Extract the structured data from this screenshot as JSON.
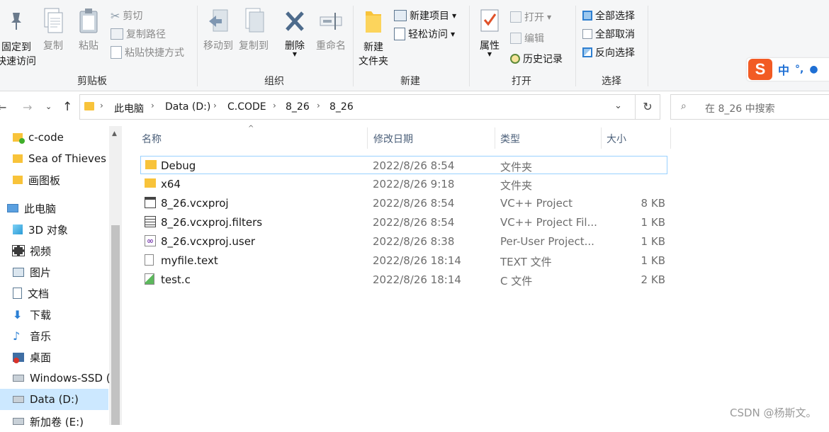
{
  "ribbon": {
    "clipboard": {
      "pin_line1": "固定到",
      "pin_line2": "快速访问",
      "copy": "复制",
      "paste": "粘贴",
      "cut": "剪切",
      "copy_path": "复制路径",
      "paste_shortcut": "粘贴快捷方式",
      "group_label": "剪贴板"
    },
    "organize": {
      "move_to": "移动到",
      "copy_to": "复制到",
      "delete": "删除",
      "rename": "重命名",
      "group_label": "组织"
    },
    "new": {
      "new_folder_line1": "新建",
      "new_folder_line2": "文件夹",
      "new_item": "新建项目",
      "easy_access": "轻松访问",
      "group_label": "新建"
    },
    "open": {
      "properties": "属性",
      "open": "打开",
      "edit": "编辑",
      "history": "历史记录",
      "group_label": "打开"
    },
    "select": {
      "select_all": "全部选择",
      "select_none": "全部取消",
      "invert": "反向选择",
      "group_label": "选择"
    }
  },
  "ime": {
    "mode": "中",
    "punct": "°,"
  },
  "address": {
    "crumbs": [
      "此电脑",
      "Data (D:)",
      "C.CODE",
      "8_26",
      "8_26"
    ],
    "search_placeholder": "在 8_26 中搜索"
  },
  "nav": {
    "items": [
      {
        "label": "c-code",
        "icon": "folder-icon"
      },
      {
        "label": "Sea of Thieves",
        "icon": "folder-icon"
      },
      {
        "label": "画图板",
        "icon": "folder-icon"
      },
      {
        "label": "此电脑",
        "icon": "pc-icon"
      },
      {
        "label": "3D 对象",
        "icon": "cube-icon"
      },
      {
        "label": "视频",
        "icon": "video-icon"
      },
      {
        "label": "图片",
        "icon": "picture-icon"
      },
      {
        "label": "文档",
        "icon": "document-icon"
      },
      {
        "label": "下载",
        "icon": "download-icon"
      },
      {
        "label": "音乐",
        "icon": "music-icon"
      },
      {
        "label": "桌面",
        "icon": "desktop-icon"
      },
      {
        "label": "Windows-SSD (",
        "icon": "drive-icon"
      },
      {
        "label": "Data (D:)",
        "icon": "drive-icon"
      },
      {
        "label": "新加卷 (E:)",
        "icon": "drive-icon"
      }
    ]
  },
  "columns": {
    "name": "名称",
    "date": "修改日期",
    "type": "类型",
    "size": "大小"
  },
  "files": [
    {
      "name": "Debug",
      "date": "2022/8/26 8:54",
      "type": "文件夹",
      "size": "",
      "icon": "folder-icon"
    },
    {
      "name": "x64",
      "date": "2022/8/26 9:18",
      "type": "文件夹",
      "size": "",
      "icon": "folder-icon"
    },
    {
      "name": "8_26.vcxproj",
      "date": "2022/8/26 8:54",
      "type": "VC++ Project",
      "size": "8 KB",
      "icon": "vcxproj-icon"
    },
    {
      "name": "8_26.vcxproj.filters",
      "date": "2022/8/26 8:54",
      "type": "VC++ Project Fil...",
      "size": "1 KB",
      "icon": "filters-icon"
    },
    {
      "name": "8_26.vcxproj.user",
      "date": "2022/8/26 8:38",
      "type": "Per-User Project...",
      "size": "1 KB",
      "icon": "vs-user-icon"
    },
    {
      "name": "myfile.text",
      "date": "2022/8/26 18:14",
      "type": "TEXT 文件",
      "size": "1 KB",
      "icon": "text-file-icon"
    },
    {
      "name": "test.c",
      "date": "2022/8/26 18:14",
      "type": "C 文件",
      "size": "2 KB",
      "icon": "c-file-icon"
    }
  ],
  "watermark": "CSDN @杨斯文。"
}
